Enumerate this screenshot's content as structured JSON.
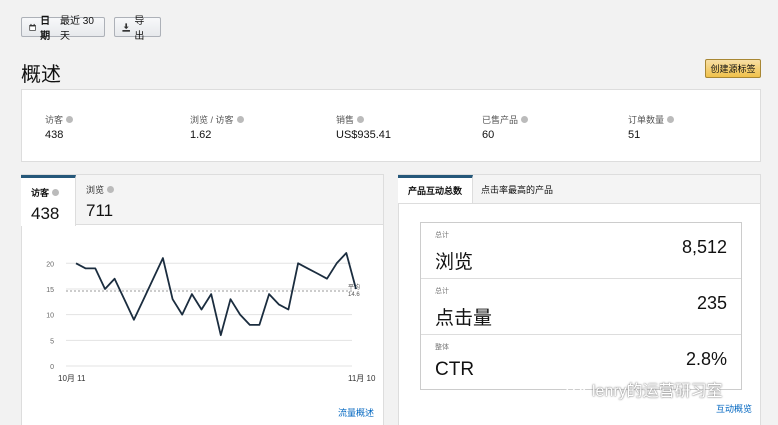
{
  "toolbar": {
    "date_label": "日期",
    "date_value": "最近 30 天",
    "export_label": "导出",
    "calendar_icon": "calendar-icon",
    "download_icon": "download-icon"
  },
  "page": {
    "title": "概述",
    "create_button": "创建源标签"
  },
  "summary": {
    "metrics": [
      {
        "label": "访客",
        "value": "438"
      },
      {
        "label": "浏览 / 访客",
        "value": "1.62"
      },
      {
        "label": "销售",
        "value": "US$935.41"
      },
      {
        "label": "已售产品",
        "value": "60"
      },
      {
        "label": "订单数量",
        "value": "51"
      }
    ]
  },
  "traffic": {
    "tabs": [
      {
        "label": "访客",
        "value": "438"
      },
      {
        "label": "浏览",
        "value": "711"
      }
    ],
    "link": "流量概述",
    "avg_label": "平均",
    "avg_value": "14.6"
  },
  "interactions": {
    "tabs": [
      "产品互动总数",
      "点击率最高的产品"
    ],
    "rows": [
      {
        "small": "总计",
        "label": "浏览",
        "value": "8,512"
      },
      {
        "small": "总计",
        "label": "点击量",
        "value": "235"
      },
      {
        "small": "整体",
        "label": "CTR",
        "value": "2.8%"
      }
    ],
    "link": "互动概览"
  },
  "watermark": "lenry的运营研习室",
  "colors": {
    "accent": "#26587a",
    "line": "#1b2d3f",
    "link": "#0066c0",
    "button_yellow": "#f0c14b"
  },
  "chart_data": {
    "type": "line",
    "x_tick_labels": [
      "10月 11",
      "11月 10"
    ],
    "yticks": [
      0,
      5,
      10,
      15,
      20
    ],
    "ylim": [
      0,
      22
    ],
    "average": 14.6,
    "grid": true,
    "series": [
      {
        "values": [
          20,
          19,
          19,
          15,
          17,
          13,
          9,
          13,
          17,
          21,
          13,
          10,
          14,
          11,
          14,
          6,
          13,
          10,
          8,
          8,
          14,
          12,
          11,
          20,
          19,
          18,
          17,
          20,
          22,
          15
        ]
      }
    ]
  }
}
